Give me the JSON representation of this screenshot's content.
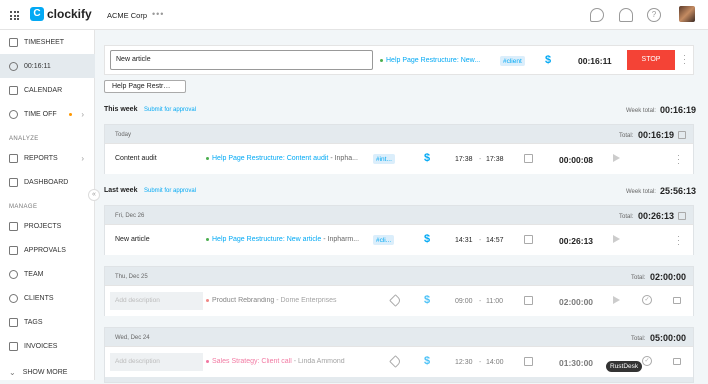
{
  "topbar": {
    "logo_text": "clockify",
    "workspace": "ACME Corp",
    "more": "•••"
  },
  "sidebar": {
    "items": [
      {
        "label": "TIMESHEET"
      },
      {
        "label": "00:16:11"
      },
      {
        "label": "CALENDAR"
      },
      {
        "label": "TIME OFF"
      },
      {
        "label": "REPORTS"
      },
      {
        "label": "DASHBOARD"
      },
      {
        "label": "PROJECTS"
      },
      {
        "label": "APPROVALS"
      },
      {
        "label": "TEAM"
      },
      {
        "label": "CLIENTS"
      },
      {
        "label": "TAGS"
      },
      {
        "label": "INVOICES"
      },
      {
        "label": "SHOW MORE"
      }
    ],
    "section_analyze": "ANALYZE",
    "section_manage": "MANAGE",
    "collapse": "«"
  },
  "tracker": {
    "description": "New article",
    "project": "Help Page Restructure: New...",
    "tag": "#client",
    "billable": "$",
    "time": "00:16:11",
    "stop": "STOP"
  },
  "chip": "Help Page Restr…",
  "this_week": {
    "label": "This week",
    "submit": "Submit for approval",
    "total_label": "Week total:",
    "total": "00:16:19"
  },
  "last_week": {
    "label": "Last week",
    "submit": "Submit for approval",
    "total_label": "Week total:",
    "total": "25:56:13"
  },
  "groups": {
    "today": {
      "date": "Today",
      "total_label": "Total:",
      "total": "00:16:19",
      "row": {
        "description": "Content audit",
        "project": "Help Page Restructure: Content audit",
        "client": "- Inpha...",
        "tag": "#int...",
        "billable": "$",
        "start": "17:38",
        "sep": "-",
        "end": "17:38",
        "duration": "00:00:08"
      }
    },
    "dec26": {
      "date": "Fri, Dec 26",
      "total_label": "Total:",
      "total": "00:26:13",
      "row": {
        "description": "New article",
        "project": "Help Page Restructure: New article",
        "client": "- Inpharm...",
        "tag": "#cli...",
        "billable": "$",
        "start": "14:31",
        "sep": "-",
        "end": "14:57",
        "duration": "00:26:13"
      }
    },
    "dec25": {
      "date": "Thu, Dec 25",
      "total_label": "Total:",
      "total": "02:00:00",
      "row": {
        "placeholder": "Add description",
        "project": "Product Rebranding",
        "client": "- Dome Enterprises",
        "billable": "$",
        "start": "09:00",
        "sep": "-",
        "end": "11:00",
        "duration": "02:00:00"
      }
    },
    "dec24": {
      "date": "Wed, Dec 24",
      "total_label": "Total:",
      "total": "05:00:00",
      "row": {
        "placeholder": "Add description",
        "project": "Sales Strategy: Client call",
        "client": "- Linda Ammond",
        "billable": "$",
        "start": "12:30",
        "sep": "-",
        "end": "14:00",
        "duration": "01:30:00"
      }
    }
  },
  "tooltip": "RustDesk",
  "colors": {
    "accent": "#03a9f4",
    "stop": "#f44336",
    "project_green": "#4caf50",
    "project_red": "#e53935",
    "project_pink": "#e91e63"
  }
}
